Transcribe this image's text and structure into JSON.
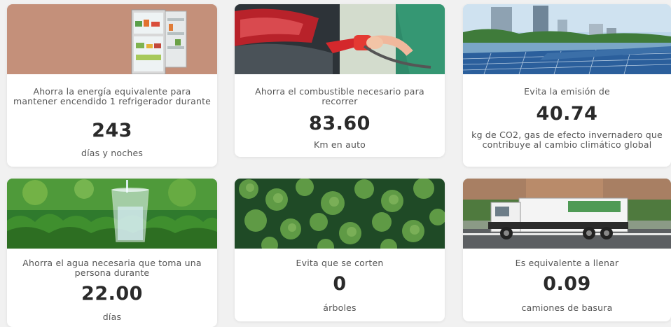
{
  "cards": [
    {
      "image": "refrigerator-photo",
      "description": "Ahorra la energía equivalente para mantener encendido 1 refrigerador durante",
      "value": "243",
      "unit": "días y noches"
    },
    {
      "image": "fuel-pump-photo",
      "description": "Ahorra el combustible necesario para recorrer",
      "value": "83.60",
      "unit": "Km en auto"
    },
    {
      "image": "solar-panels-photo",
      "description": "Evita la emisión de",
      "value": "40.74",
      "unit": "kg de CO2, gas de efecto invernadero que contribuye al cambio climático global"
    },
    {
      "image": "water-glass-photo",
      "description": "Ahorra el agua necesaria que toma una persona durante",
      "value": "22.00",
      "unit": "días"
    },
    {
      "image": "forest-photo",
      "description": "Evita que se corten",
      "value": "0",
      "unit": "árboles"
    },
    {
      "image": "garbage-truck-photo",
      "description": "Es equivalente a llenar",
      "value": "0.09",
      "unit": "camiones de basura"
    }
  ],
  "colors": {
    "background": "#f1f1f1",
    "card": "#ffffff",
    "value_text": "#2a2a2a",
    "body_text": "#555555"
  }
}
